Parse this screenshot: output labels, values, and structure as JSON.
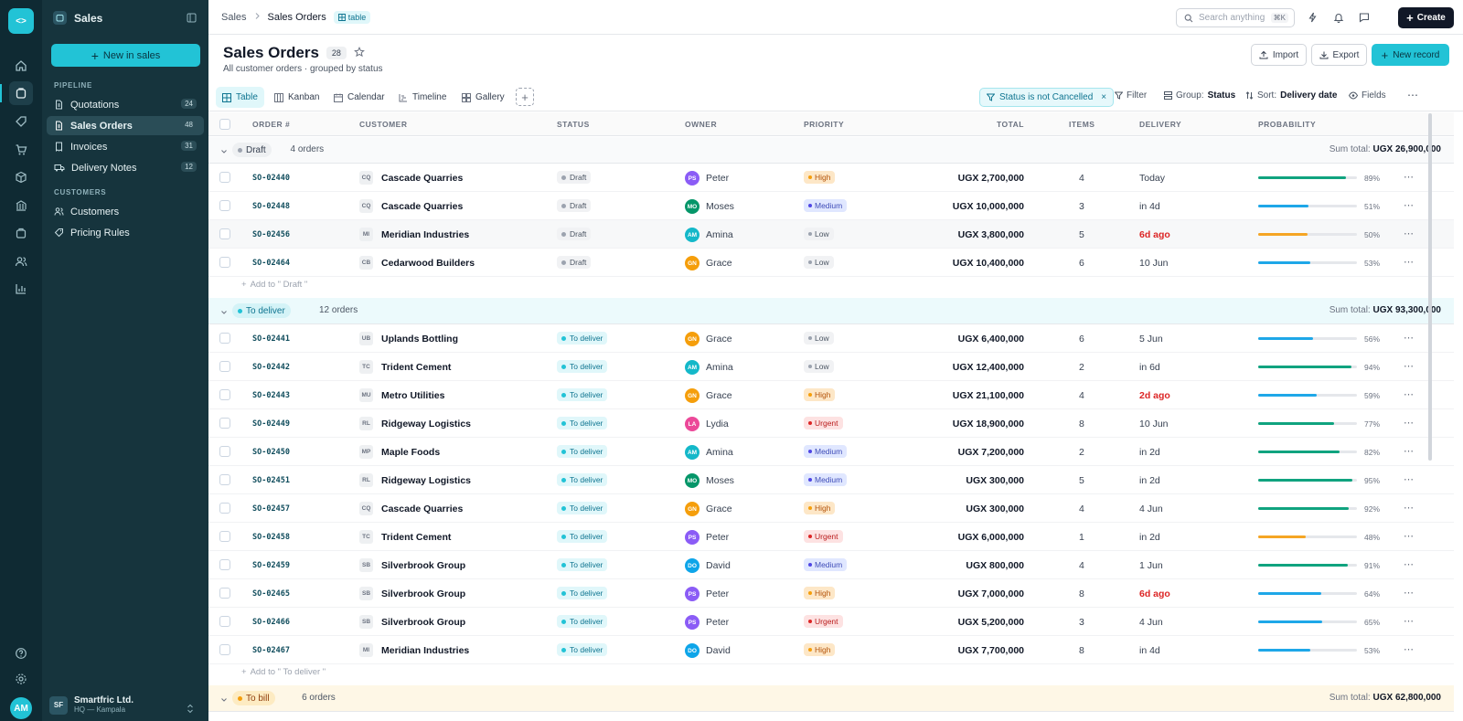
{
  "rail": {
    "logo": "<>",
    "user_initials": "AM"
  },
  "sidebar": {
    "workspace": "Sales",
    "new_button": "New in  sales",
    "sections": [
      {
        "title": "PIPELINE",
        "items": [
          {
            "label": "Quotations",
            "count": "24"
          },
          {
            "label": "Sales Orders",
            "count": "48",
            "active": true
          },
          {
            "label": "Invoices",
            "count": "31"
          },
          {
            "label": "Delivery Notes",
            "count": "12"
          }
        ]
      },
      {
        "title": "CUSTOMERS",
        "items": [
          {
            "label": "Customers"
          },
          {
            "label": "Pricing Rules"
          }
        ]
      }
    ],
    "org": {
      "initials": "SF",
      "name": "Smartfric Ltd.",
      "sub": "HQ — Kampala"
    }
  },
  "topbar": {
    "breadcrumb": [
      "Sales",
      "Sales Orders"
    ],
    "view_tag": "table",
    "search_placeholder": "Search anything",
    "search_kbd": "⌘K",
    "create_label": "Create"
  },
  "page": {
    "title": "Sales Orders",
    "count": "28",
    "subtitle": "All customer orders · grouped by status",
    "import_label": "Import",
    "export_label": "Export",
    "new_record_label": "New record"
  },
  "views": [
    "Table",
    "Kanban",
    "Calendar",
    "Timeline",
    "Gallery"
  ],
  "active_view": "Table",
  "filters": {
    "chip": "Status is not Cancelled",
    "filter_label": "Filter",
    "group_label": "Group:",
    "group_value": "Status",
    "sort_label": "Sort:",
    "sort_value": "Delivery date",
    "fields_label": "Fields"
  },
  "columns": [
    "ORDER #",
    "CUSTOMER",
    "STATUS",
    "OWNER",
    "PRIORITY",
    "TOTAL",
    "ITEMS",
    "DELIVERY",
    "PROBABILITY"
  ],
  "colors": {
    "accent": "#22c3d6",
    "sidebar": "#16343d",
    "rail": "#0f2a33",
    "overdue": "#dc2626"
  },
  "groups": [
    {
      "label": "Draft",
      "count": "4 orders",
      "sum_label": "Sum total:",
      "sum": "UGX 26,900,000",
      "add_label": "Add to \" Draft \"",
      "rows": [
        {
          "order": "SO-02440",
          "cust_init": "CQ",
          "customer": "Cascade Quarries",
          "status": "Draft",
          "owner_init": "PS",
          "owner": "Peter",
          "priority": "High",
          "total": "UGX 2,700,000",
          "items": "4",
          "delivery": "Today",
          "overdue": false,
          "prob": 89
        },
        {
          "order": "SO-02448",
          "cust_init": "CQ",
          "customer": "Cascade Quarries",
          "status": "Draft",
          "owner_init": "MO",
          "owner": "Moses",
          "priority": "Medium",
          "total": "UGX 10,000,000",
          "items": "3",
          "delivery": "in 4d",
          "overdue": false,
          "prob": 51
        },
        {
          "order": "SO-02456",
          "cust_init": "MI",
          "customer": "Meridian Industries",
          "status": "Draft",
          "owner_init": "AM",
          "owner": "Amina",
          "priority": "Low",
          "total": "UGX 3,800,000",
          "items": "5",
          "delivery": "6d ago",
          "overdue": true,
          "prob": 50
        },
        {
          "order": "SO-02464",
          "cust_init": "CB",
          "customer": "Cedarwood Builders",
          "status": "Draft",
          "owner_init": "GN",
          "owner": "Grace",
          "priority": "Low",
          "total": "UGX 10,400,000",
          "items": "6",
          "delivery": "10 Jun",
          "overdue": false,
          "prob": 53
        }
      ]
    },
    {
      "label": "To deliver",
      "count": "12 orders",
      "sum_label": "Sum total:",
      "sum": "UGX 93,300,000",
      "add_label": "Add to \" To deliver \"",
      "rows": [
        {
          "order": "SO-02441",
          "cust_init": "UB",
          "customer": "Uplands Bottling",
          "status": "To deliver",
          "owner_init": "GN",
          "owner": "Grace",
          "priority": "Low",
          "total": "UGX 6,400,000",
          "items": "6",
          "delivery": "5 Jun",
          "overdue": false,
          "prob": 56
        },
        {
          "order": "SO-02442",
          "cust_init": "TC",
          "customer": "Trident Cement",
          "status": "To deliver",
          "owner_init": "AM",
          "owner": "Amina",
          "priority": "Low",
          "total": "UGX 12,400,000",
          "items": "2",
          "delivery": "in 6d",
          "overdue": false,
          "prob": 94
        },
        {
          "order": "SO-02443",
          "cust_init": "MU",
          "customer": "Metro Utilities",
          "status": "To deliver",
          "owner_init": "GN",
          "owner": "Grace",
          "priority": "High",
          "total": "UGX 21,100,000",
          "items": "4",
          "delivery": "2d ago",
          "overdue": true,
          "prob": 59
        },
        {
          "order": "SO-02449",
          "cust_init": "RL",
          "customer": "Ridgeway Logistics",
          "status": "To deliver",
          "owner_init": "LA",
          "owner": "Lydia",
          "priority": "Urgent",
          "total": "UGX 18,900,000",
          "items": "8",
          "delivery": "10 Jun",
          "overdue": false,
          "prob": 77
        },
        {
          "order": "SO-02450",
          "cust_init": "MP",
          "customer": "Maple Foods",
          "status": "To deliver",
          "owner_init": "AM",
          "owner": "Amina",
          "priority": "Medium",
          "total": "UGX 7,200,000",
          "items": "2",
          "delivery": "in 2d",
          "overdue": false,
          "prob": 82
        },
        {
          "order": "SO-02451",
          "cust_init": "RL",
          "customer": "Ridgeway Logistics",
          "status": "To deliver",
          "owner_init": "MO",
          "owner": "Moses",
          "priority": "Medium",
          "total": "UGX 300,000",
          "items": "5",
          "delivery": "in 2d",
          "overdue": false,
          "prob": 95
        },
        {
          "order": "SO-02457",
          "cust_init": "CQ",
          "customer": "Cascade Quarries",
          "status": "To deliver",
          "owner_init": "GN",
          "owner": "Grace",
          "priority": "High",
          "total": "UGX 300,000",
          "items": "4",
          "delivery": "4 Jun",
          "overdue": false,
          "prob": 92
        },
        {
          "order": "SO-02458",
          "cust_init": "TC",
          "customer": "Trident Cement",
          "status": "To deliver",
          "owner_init": "PS",
          "owner": "Peter",
          "priority": "Urgent",
          "total": "UGX 6,000,000",
          "items": "1",
          "delivery": "in 2d",
          "overdue": false,
          "prob": 48
        },
        {
          "order": "SO-02459",
          "cust_init": "SB",
          "customer": "Silverbrook Group",
          "status": "To deliver",
          "owner_init": "DO",
          "owner": "David",
          "priority": "Medium",
          "total": "UGX 800,000",
          "items": "4",
          "delivery": "1 Jun",
          "overdue": false,
          "prob": 91
        },
        {
          "order": "SO-02465",
          "cust_init": "SB",
          "customer": "Silverbrook Group",
          "status": "To deliver",
          "owner_init": "PS",
          "owner": "Peter",
          "priority": "High",
          "total": "UGX 7,000,000",
          "items": "8",
          "delivery": "6d ago",
          "overdue": true,
          "prob": 64
        },
        {
          "order": "SO-02466",
          "cust_init": "SB",
          "customer": "Silverbrook Group",
          "status": "To deliver",
          "owner_init": "PS",
          "owner": "Peter",
          "priority": "Urgent",
          "total": "UGX 5,200,000",
          "items": "3",
          "delivery": "4 Jun",
          "overdue": false,
          "prob": 65
        },
        {
          "order": "SO-02467",
          "cust_init": "MI",
          "customer": "Meridian Industries",
          "status": "To deliver",
          "owner_init": "DO",
          "owner": "David",
          "priority": "High",
          "total": "UGX 7,700,000",
          "items": "8",
          "delivery": "in 4d",
          "overdue": false,
          "prob": 53
        }
      ]
    },
    {
      "label": "To bill",
      "count": "6 orders",
      "sum_label": "Sum total:",
      "sum": "UGX 62,800,000",
      "add_label": "",
      "rows": []
    }
  ]
}
